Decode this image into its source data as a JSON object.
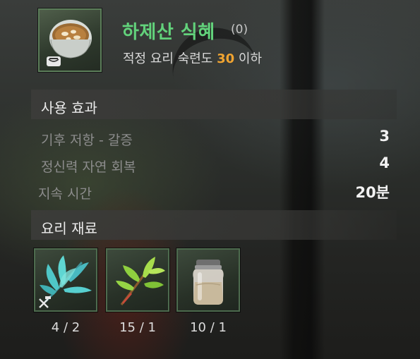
{
  "item": {
    "name": "하제산 식혜",
    "count": "(0)",
    "requirement_prefix": "적정 요리 숙련도",
    "requirement_level": "30",
    "requirement_suffix": "이하",
    "icon": "sikhye-bowl-icon"
  },
  "effects": {
    "title": "사용 효과",
    "rows": [
      {
        "label": "기후 저항 - 갈증",
        "value": "3"
      },
      {
        "label": "정신력 자연 회복",
        "value": "4"
      },
      {
        "label": "지속 시간",
        "value": "20분"
      }
    ]
  },
  "ingredients": {
    "title": "요리 재료",
    "items": [
      {
        "icon": "blue-herb-icon",
        "count": "4 / 2"
      },
      {
        "icon": "green-herb-icon",
        "count": "15 / 1"
      },
      {
        "icon": "sugar-jar-icon",
        "count": "10 / 1"
      }
    ]
  },
  "colors": {
    "name_green": "#62d27b",
    "level_orange": "#f0a431",
    "frame_green": "#5b7d59"
  }
}
